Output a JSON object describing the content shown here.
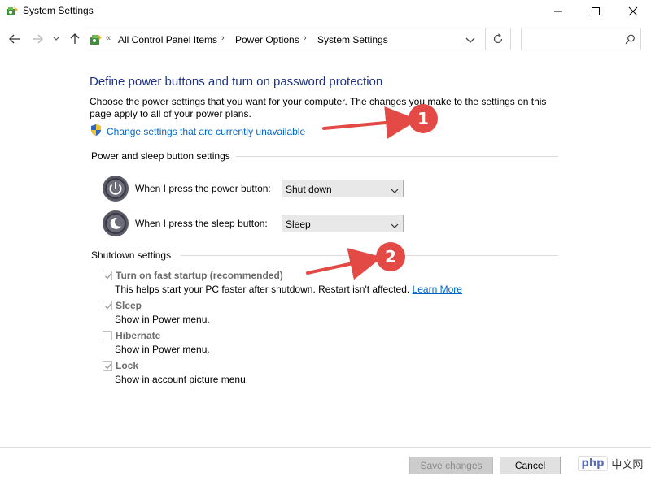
{
  "window": {
    "title": "System Settings",
    "app_icon": "power-options-icon"
  },
  "nav": {
    "breadcrumbs": [
      "All Control Panel Items",
      "Power Options",
      "System Settings"
    ],
    "overflow_label": "«",
    "search_placeholder": ""
  },
  "main": {
    "heading": "Define power buttons and turn on password protection",
    "description": "Choose the power settings that you want for your computer. The changes you make to the settings on this page apply to all of your power plans.",
    "change_link": "Change settings that are currently unavailable"
  },
  "power_group": {
    "label": "Power and sleep button settings",
    "power_button_label": "When I press the power button:",
    "power_button_value": "Shut down",
    "sleep_button_label": "When I press the sleep button:",
    "sleep_button_value": "Sleep"
  },
  "shutdown_group": {
    "label": "Shutdown settings",
    "items": [
      {
        "label": "Turn on fast startup (recommended)",
        "desc": "This helps start your PC faster after shutdown. Restart isn't affected.",
        "checked": true,
        "link": "Learn More"
      },
      {
        "label": "Sleep",
        "desc": "Show in Power menu.",
        "checked": true
      },
      {
        "label": "Hibernate",
        "desc": "Show in Power menu.",
        "checked": false
      },
      {
        "label": "Lock",
        "desc": "Show in account picture menu.",
        "checked": true
      }
    ]
  },
  "annotations": [
    {
      "number": "1",
      "color": "#e34a45"
    },
    {
      "number": "2",
      "color": "#e34a45"
    }
  ],
  "footer": {
    "save_label": "Save changes",
    "cancel_label": "Cancel"
  },
  "watermark": {
    "logo": "php",
    "text": "中文网"
  },
  "colors": {
    "heading": "#1e3287",
    "link": "#0066cc",
    "annotation": "#e34a45"
  }
}
